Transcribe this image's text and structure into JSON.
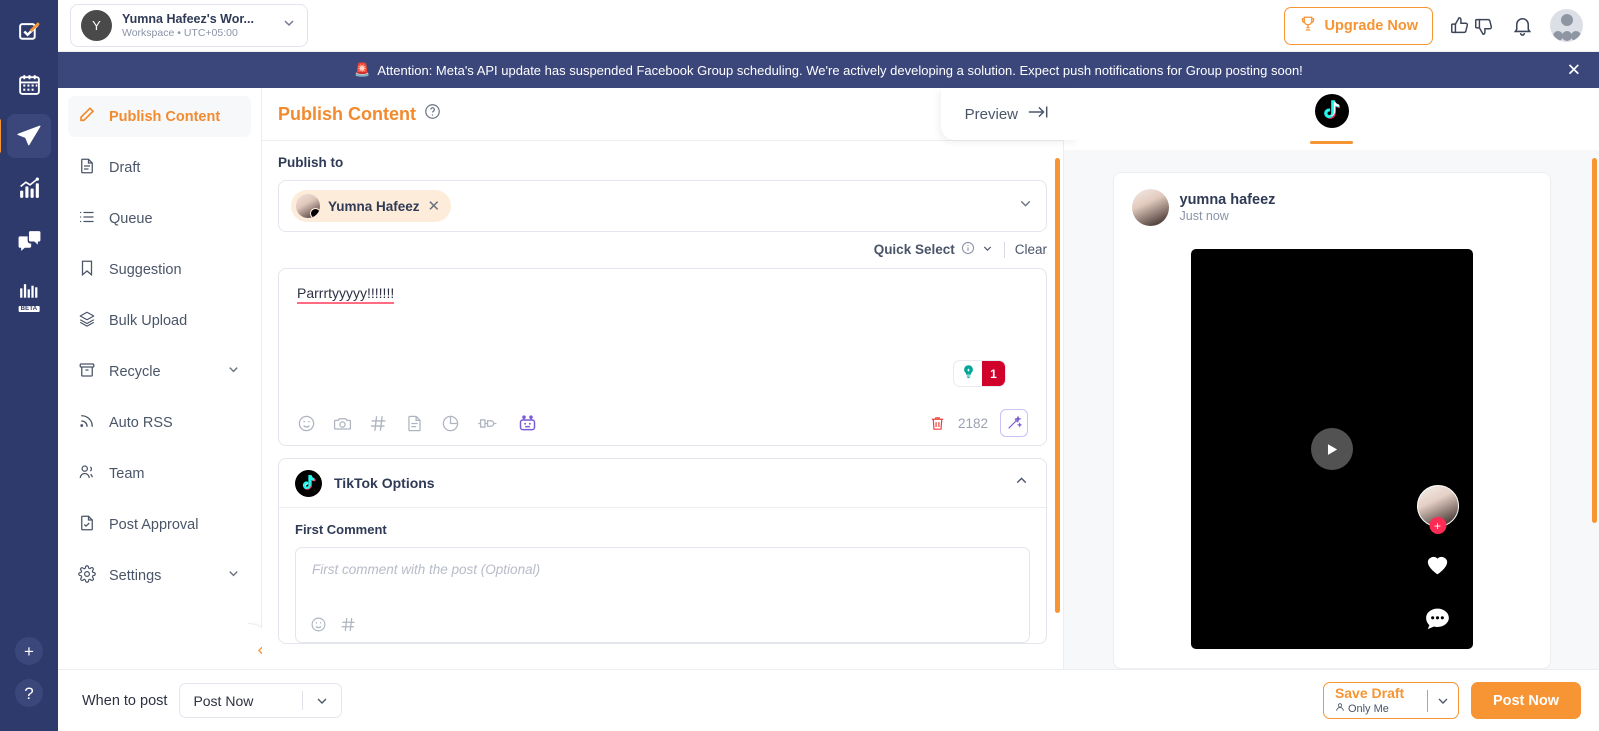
{
  "rail": {
    "items": [
      {
        "name": "compose-icon",
        "label": "Compose"
      },
      {
        "name": "calendar-icon",
        "label": "Calendar"
      },
      {
        "name": "publish-icon",
        "label": "Publish"
      },
      {
        "name": "analytics-icon",
        "label": "Analytics"
      },
      {
        "name": "inbox-icon",
        "label": "Inbox"
      },
      {
        "name": "reports-icon",
        "label": "Reports",
        "badge": "BETA"
      }
    ],
    "add_label": "+",
    "help_label": "?"
  },
  "topbar": {
    "workspace_initial": "Y",
    "workspace_name": "Yumna Hafeez's Wor...",
    "workspace_sub": "Workspace • UTC+05:00",
    "upgrade_label": "Upgrade Now",
    "icons": [
      "trophy-icon",
      "thumbs-up-icon",
      "thumbs-down-icon",
      "bell-icon",
      "avatar"
    ]
  },
  "banner": {
    "emoji": "🚨",
    "text": "Attention: Meta's API update has suspended Facebook Group scheduling. We're actively developing a solution. Expect push notifications for Group posting soon!",
    "close_label": "✕"
  },
  "sidemenu": {
    "items": [
      {
        "label": "Publish Content",
        "icon": "pencil-icon",
        "active": true,
        "chevron": false
      },
      {
        "label": "Draft",
        "icon": "document-icon",
        "active": false,
        "chevron": false
      },
      {
        "label": "Queue",
        "icon": "list-icon",
        "active": false,
        "chevron": false
      },
      {
        "label": "Suggestion",
        "icon": "bookmark-icon",
        "active": false,
        "chevron": false
      },
      {
        "label": "Bulk Upload",
        "icon": "layers-icon",
        "active": false,
        "chevron": false
      },
      {
        "label": "Recycle",
        "icon": "archive-icon",
        "active": false,
        "chevron": true
      },
      {
        "label": "Auto RSS",
        "icon": "rss-icon",
        "active": false,
        "chevron": false
      },
      {
        "label": "Team",
        "icon": "users-icon",
        "active": false,
        "chevron": false
      },
      {
        "label": "Post Approval",
        "icon": "document-check-icon",
        "active": false,
        "chevron": false
      },
      {
        "label": "Settings",
        "icon": "gear-icon",
        "active": false,
        "chevron": true
      }
    ]
  },
  "main": {
    "page_title": "Publish Content",
    "preview_label": "Preview",
    "publish_to_label": "Publish to",
    "account_chip": {
      "name": "Yumna Hafeez",
      "remove_label": "✕",
      "network": "tiktok"
    },
    "quick_select_label": "Quick Select",
    "clear_label": "Clear",
    "editor": {
      "content": "Parrrtyyyyy!!!!!!!",
      "char_count": "2182",
      "tip_count": "1",
      "toolbar_icons": [
        "emoji-icon",
        "camera-icon",
        "hashtag-icon",
        "document-icon",
        "chart-icon",
        "plug-icon",
        "robot-icon"
      ],
      "right_icons": [
        "trash-icon",
        "magic-wand-icon"
      ]
    },
    "tiktok_options": {
      "title": "TikTok Options",
      "first_comment_label": "First Comment",
      "first_comment_placeholder": "First comment with the post (Optional)",
      "first_comment_value": "",
      "icons": [
        "emoji-icon",
        "hashtag-icon"
      ]
    }
  },
  "preview": {
    "tab": "tiktok",
    "user_name": "yumna hafeez",
    "timestamp": "Just now",
    "play_label": "▶",
    "follow_label": "+"
  },
  "bottombar": {
    "when_label": "When to post",
    "when_value": "Post Now",
    "save_draft_label": "Save Draft",
    "save_draft_sub": "Only Me",
    "post_now_label": "Post Now"
  },
  "colors": {
    "accent": "#f79433",
    "navy": "#2e3a6b",
    "banner": "#3b477b",
    "danger": "#d0022b",
    "tiktok_pink": "#fe2c55"
  }
}
